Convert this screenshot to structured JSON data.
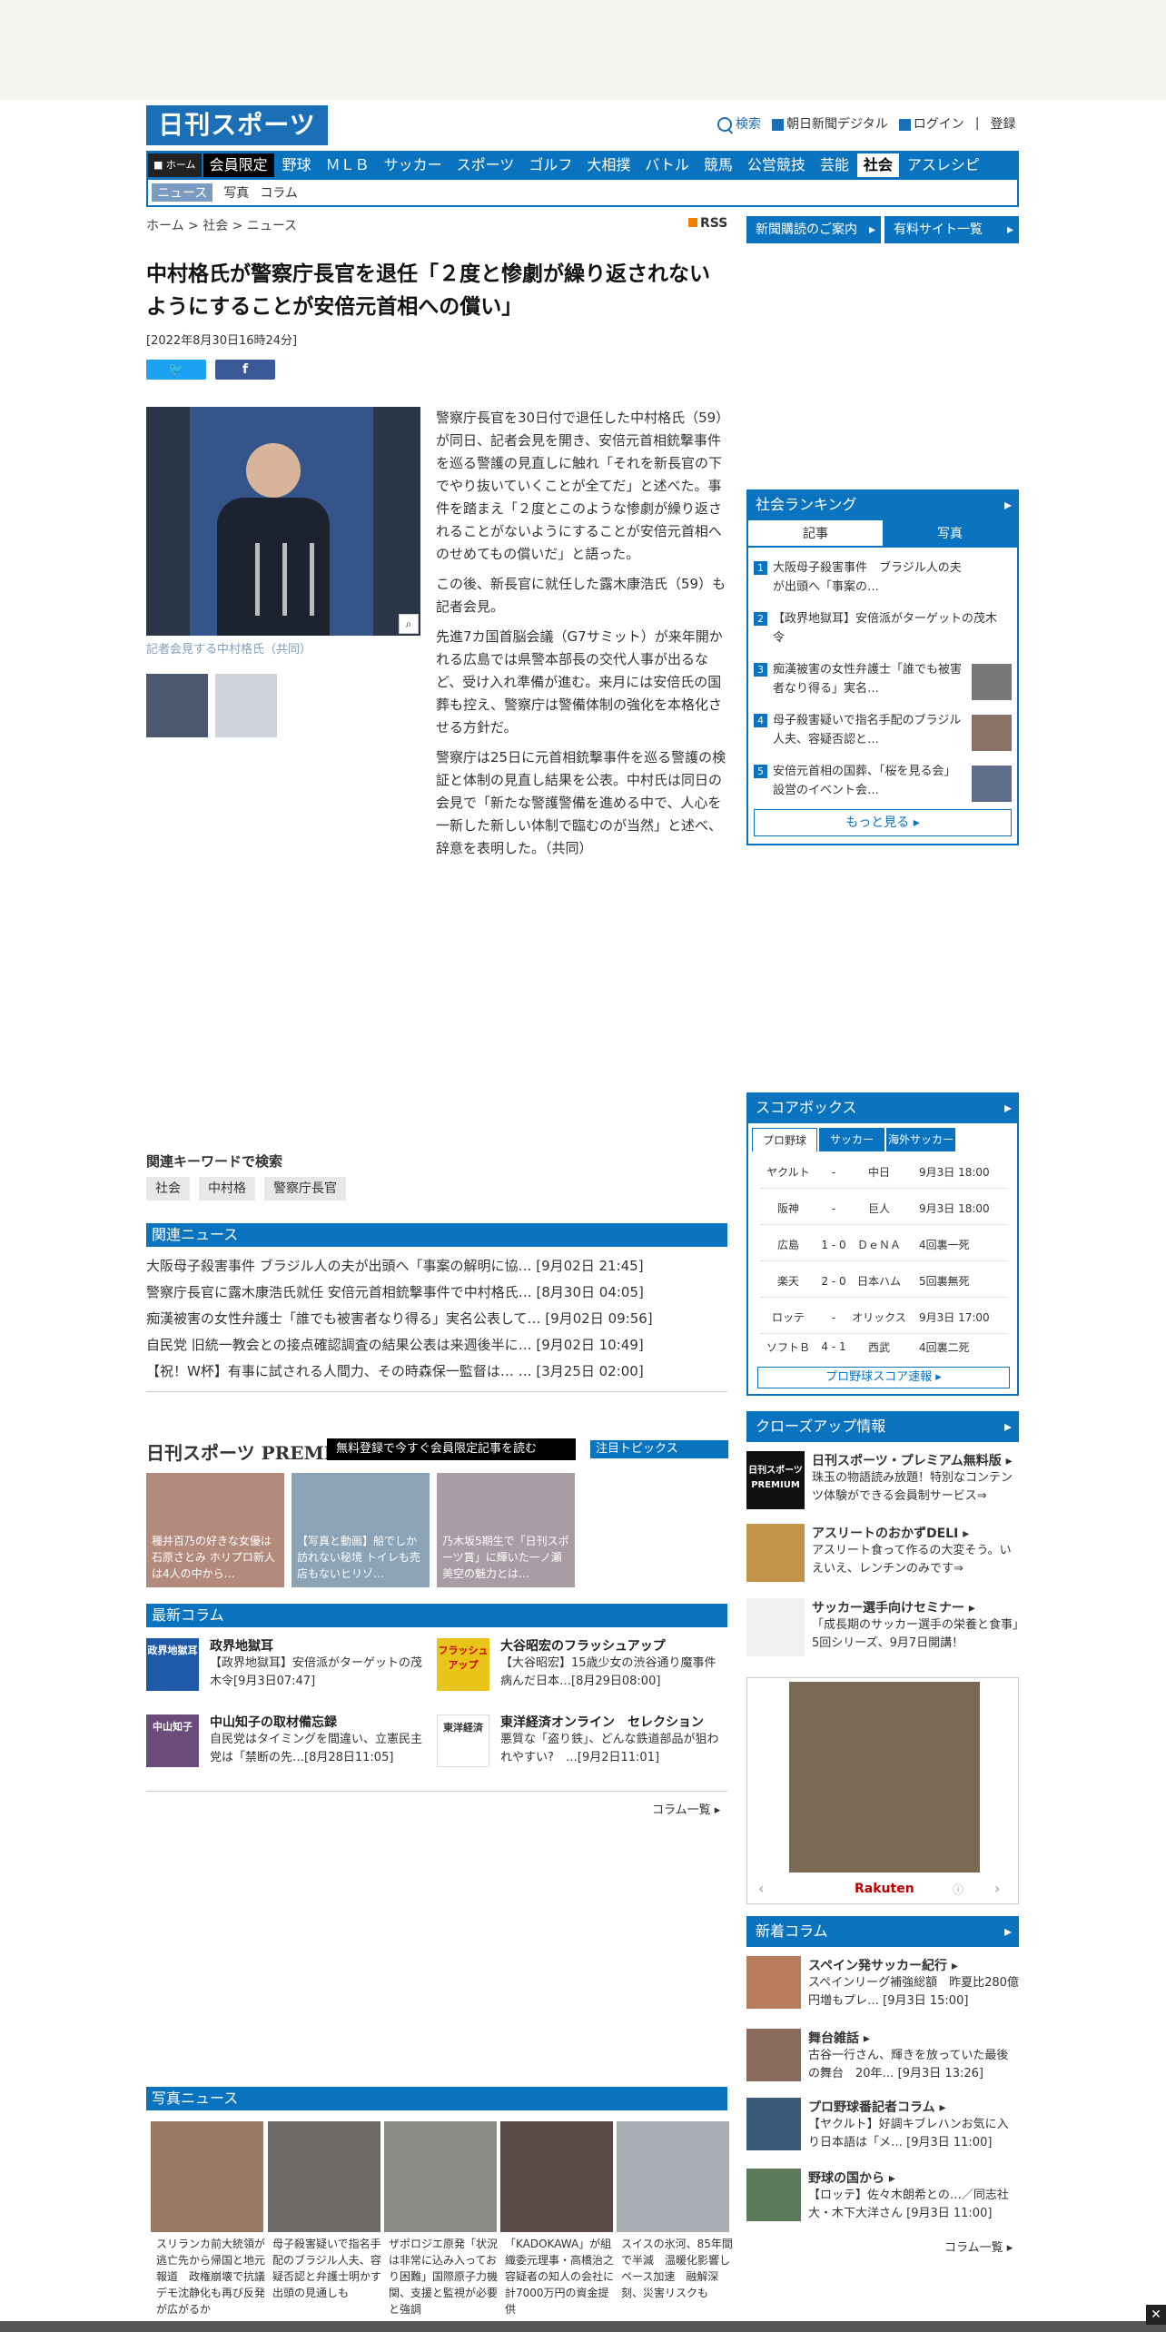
{
  "header": {
    "logo": "日刊スポーツ",
    "search": "検索",
    "asahi": "朝日新聞デジタル",
    "login": "ログイン",
    "register": "登録"
  },
  "nav": {
    "home": "ホーム",
    "items": [
      "会員限定",
      "野球",
      "ＭＬＢ",
      "サッカー",
      "スポーツ",
      "ゴルフ",
      "大相撲",
      "バトル",
      "競馬",
      "公営競技",
      "芸能",
      "社会",
      "アスレシピ"
    ],
    "sub": [
      "ニュース",
      "写真",
      "コラム"
    ]
  },
  "breadcrumb": "ホーム > 社会 > ニュース",
  "rss": "RSS",
  "side_buttons": [
    "新聞購読のご案内",
    "有料サイト一覧"
  ],
  "article": {
    "title": "中村格氏が警察庁長官を退任「２度と惨劇が繰り返されないようにすることが安倍元首相への償い」",
    "date": "[2022年8月30日16時24分]",
    "caption": "記者会見する中村格氏（共同）",
    "paragraphs": [
      "警察庁長官を30日付で退任した中村格氏（59）が同日、記者会見を開き、安倍元首相銃撃事件を巡る警護の見直しに触れ「それを新長官の下でやり抜いていくことが全てだ」と述べた。事件を踏まえ「２度とこのような惨劇が繰り返されることがないようにすることが安倍元首相へのせめてもの償いだ」と語った。",
      "この後、新長官に就任した露木康浩氏（59）も記者会見。",
      "先進7カ国首脳会議（G7サミット）が来年開かれる広島では県警本部長の交代人事が出るなど、受け入れ準備が進む。来月には安倍氏の国葬も控え、警察庁は警備体制の強化を本格化させる方針だ。",
      "警察庁は25日に元首相銃撃事件を巡る警護の検証と体制の見直し結果を公表。中村氏は同日の会見で「新たな警護警備を進める中で、人心を一新した新しい体制で臨むのが当然」と述べ、辞意を表明した。（共同）"
    ]
  },
  "keywords": {
    "title": "関連キーワードで検索",
    "items": [
      "社会",
      "中村格",
      "警察庁長官"
    ]
  },
  "related": {
    "title": "関連ニュース",
    "items": [
      "大阪母子殺害事件 ブラジル人の夫が出頭へ「事案の解明に協… [9月02日 21:45]",
      "警察庁長官に露木康浩氏就任 安倍元首相銃撃事件で中村格氏… [8月30日 04:05]",
      "痴漢被害の女性弁護士「誰でも被害者なり得る」実名公表して… [9月02日 09:56]",
      "自民党 旧統一教会との接点確認調査の結果公表は来週後半に… [9月02日 10:49]",
      "【祝！W杯】有事に試される人間力、その時森保一監督は… … [3月25日 02:00]"
    ]
  },
  "premium": {
    "title": "日刊スポーツ PREMIUM",
    "cta": "無料登録で今すぐ会員限定記事を読む",
    "topics": "注目トピックス",
    "cards": [
      "種井百乃の好きな女優は石原さとみ ホリプロ新人は4人の中から…",
      "【写真と動画】船でしか訪れない秘境 トイレも売店もないヒリゾ…",
      "乃木坂5期生で「日刊スポーツ賞」に輝いた一ノ瀬美空の魅力とは…"
    ]
  },
  "columns": {
    "title": "最新コラム",
    "items": [
      {
        "name": "政界地獄耳",
        "body": "【政界地獄耳】安倍派がターゲットの茂木令[9月3日07:47]"
      },
      {
        "name": "大谷昭宏のフラッシュアップ",
        "body": "【大谷昭宏】15歳少女の渋谷通り魔事件　病んだ日本…[8月29日08:00]"
      },
      {
        "name": "中山知子の取材備忘録",
        "body": "自民党はタイミングを間違い、立憲民主党は「禁断の先…[8月28日11:05]"
      },
      {
        "name": "東洋経済オンライン　セレクション",
        "body": "悪質な「盗り鉄」、どんな鉄道部品が狙われやすい?　…[9月2日11:01]"
      }
    ],
    "img_labels": [
      "政界地獄耳",
      "フラッシュアップ",
      "中山知子",
      "東洋経済"
    ],
    "all": "コラム一覧 ▸"
  },
  "photo_news": {
    "title": "写真ニュース",
    "items": [
      "スリランカ前大統領が逃亡先から帰国と地元報道　政権崩壊で抗議デモ沈静化も再び反発が広がるか",
      "母子殺害疑いで指名手配のブラジル人夫、容疑否認と弁護士明かす　出頭の見通しも",
      "ザポロジエ原発「状況は非常に込み入っており困難」国際原子力機関、支援と監視が必要と強調",
      "「KADOKAWA」が組織委元理事・高橋治之容疑者の知人の会社に計7000万円の資金提供",
      "スイスの氷河、85年間で半減　温暖化影響しペース加速　融解深刻、災害リスクも"
    ]
  },
  "ranking": {
    "title": "社会ランキング",
    "tabs": [
      "記事",
      "写真"
    ],
    "items": [
      "大阪母子殺害事件　ブラジル人の夫が出頭へ「事案の…",
      "【政界地獄耳】安倍派がターゲットの茂木令",
      "痴漢被害の女性弁護士「誰でも被害者なり得る」実名…",
      "母子殺害疑いで指名手配のブラジル人夫、容疑否認と…",
      "安倍元首相の国葬、「桜を見る会」設営のイベント会…"
    ],
    "more": "もっと見る ▸"
  },
  "scorebox": {
    "title": "スコアボックス",
    "tabs": [
      "プロ野球",
      "サッカー",
      "海外サッカー"
    ],
    "rows": [
      [
        "ヤクルト",
        "-",
        "中日",
        "9月3日 18:00"
      ],
      [
        "阪神",
        "-",
        "巨人",
        "9月3日 18:00"
      ],
      [
        "広島",
        "1 - 0",
        "ＤｅＮＡ",
        "4回裏一死"
      ],
      [
        "楽天",
        "2 - 0",
        "日本ハム",
        "5回裏無死"
      ],
      [
        "ロッテ",
        "-",
        "オリックス",
        "9月3日 17:00"
      ],
      [
        "ソフトＢ",
        "4 - 1",
        "西武",
        "4回裏二死"
      ]
    ],
    "button": "プロ野球スコア速報 ▸"
  },
  "closeup": {
    "title": "クローズアップ情報",
    "items": [
      {
        "title": "日刊スポーツ・プレミアム無料版 ▸",
        "body": "珠玉の物語読み放題！特別なコンテンツ体験ができる会員制サービス⇒"
      },
      {
        "title": "アスリートのおかずDELI ▸",
        "body": "アスリート食って作るの大変そう。いえいえ、レンチンのみです⇒"
      },
      {
        "title": "サッカー選手向けセミナー ▸",
        "body": "「成長期のサッカー選手の栄養と食事」5回シリーズ、9月7日開講！"
      }
    ],
    "img_label": "日刊スポーツ PREMIUM"
  },
  "rakuten": "Rakuten",
  "new_columns": {
    "title": "新着コラム",
    "items": [
      {
        "title": "スペイン発サッカー紀行 ▸",
        "body": "スペインリーグ補強総額　昨夏比280億円増もプレ… [9月3日 15:00]"
      },
      {
        "title": "舞台雑話 ▸",
        "body": "古谷一行さん、輝きを放っていた最後の舞台　20年… [9月3日 13:26]"
      },
      {
        "title": "プロ野球番記者コラム ▸",
        "body": "【ヤクルト】好調キブレハンお気に入り日本語は「メ… [9月3日 11:00]"
      },
      {
        "title": "野球の国から ▸",
        "body": "【ロッテ】佐々木朗希との…／同志社大・木下大洋さん [9月3日 11:00]"
      }
    ],
    "all": "コラム一覧 ▸"
  },
  "colors": {
    "brand": "#0a73c0",
    "accent_orange": "#f08000"
  }
}
